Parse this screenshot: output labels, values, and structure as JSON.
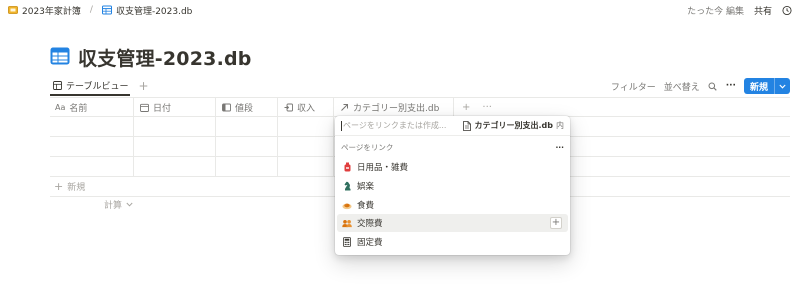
{
  "breadcrumb": {
    "parent": "2023年家計簿",
    "separator": "/",
    "current": "収支管理-2023.db"
  },
  "topbar": {
    "edited": "たった今 編集",
    "share": "共有"
  },
  "page": {
    "title": "収支管理-2023.db"
  },
  "viewbar": {
    "tab_label": "テーブルビュー",
    "add": "+",
    "filter": "フィルター",
    "sort": "並べ替え",
    "more": "···",
    "new_label": "新規"
  },
  "table": {
    "columns": [
      {
        "label": "名前",
        "icon_text": "Aa"
      },
      {
        "label": "日付"
      },
      {
        "label": "値段"
      },
      {
        "label": "収入"
      },
      {
        "label": "カテゴリー別支出.db"
      }
    ],
    "header_add": "+",
    "header_more": "···",
    "row_count": 3,
    "new_row": "新規",
    "calc": "計算"
  },
  "popup": {
    "placeholder": "ページをリンクまたは作成...",
    "target_db": "カテゴリー別支出.db",
    "target_suffix": "内",
    "section_label": "ページをリンク",
    "section_more": "···",
    "items": [
      {
        "label": "日用品・雑費",
        "icon": "red-bottle-icon",
        "color": "#e03e3e"
      },
      {
        "label": "娯楽",
        "icon": "chess-knight-icon",
        "color": "#2f6f5e"
      },
      {
        "label": "食費",
        "icon": "food-plate-icon",
        "color": "#d9730d"
      },
      {
        "label": "交際費",
        "icon": "people-icon",
        "color": "#d9730d"
      },
      {
        "label": "固定費",
        "icon": "calculator-icon",
        "color": "#37352f"
      }
    ],
    "highlighted_index": 3
  },
  "colors": {
    "accent": "#2383e2",
    "text": "#37352f",
    "muted": "#787774",
    "border": "#e9e9e7"
  }
}
